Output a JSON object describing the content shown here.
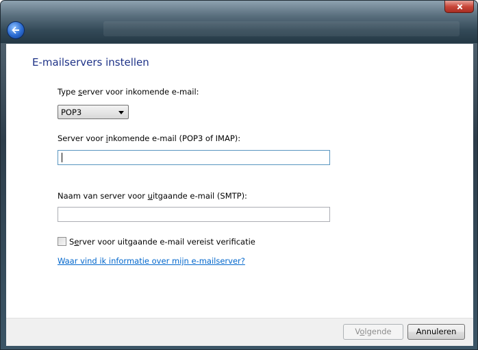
{
  "window": {
    "back_icon": "back-arrow-icon",
    "close_icon": "close-icon"
  },
  "main": {
    "title": "E-mailservers instellen",
    "incoming_type": {
      "label_pre": "Type ",
      "label_u": "s",
      "label_post": "erver voor inkomende e-mail:",
      "selected": "POP3"
    },
    "incoming_server": {
      "label_pre": "Server voor ",
      "label_u": "i",
      "label_post": "nkomende e-mail (POP3 of IMAP):",
      "value": ""
    },
    "outgoing_server": {
      "label_pre": "Naam van server voor ",
      "label_u": "u",
      "label_post": "itgaande e-mail (SMTP):",
      "value": ""
    },
    "auth_checkbox": {
      "label_pre": "S",
      "label_u": "e",
      "label_post": "rver voor uitgaande e-mail vereist verificatie",
      "checked": false
    },
    "help_link": "Waar vind ik informatie over mijn e-mailserver?"
  },
  "footer": {
    "next_pre": "V",
    "next_u": "o",
    "next_post": "lgende",
    "cancel_label": "Annuleren"
  }
}
